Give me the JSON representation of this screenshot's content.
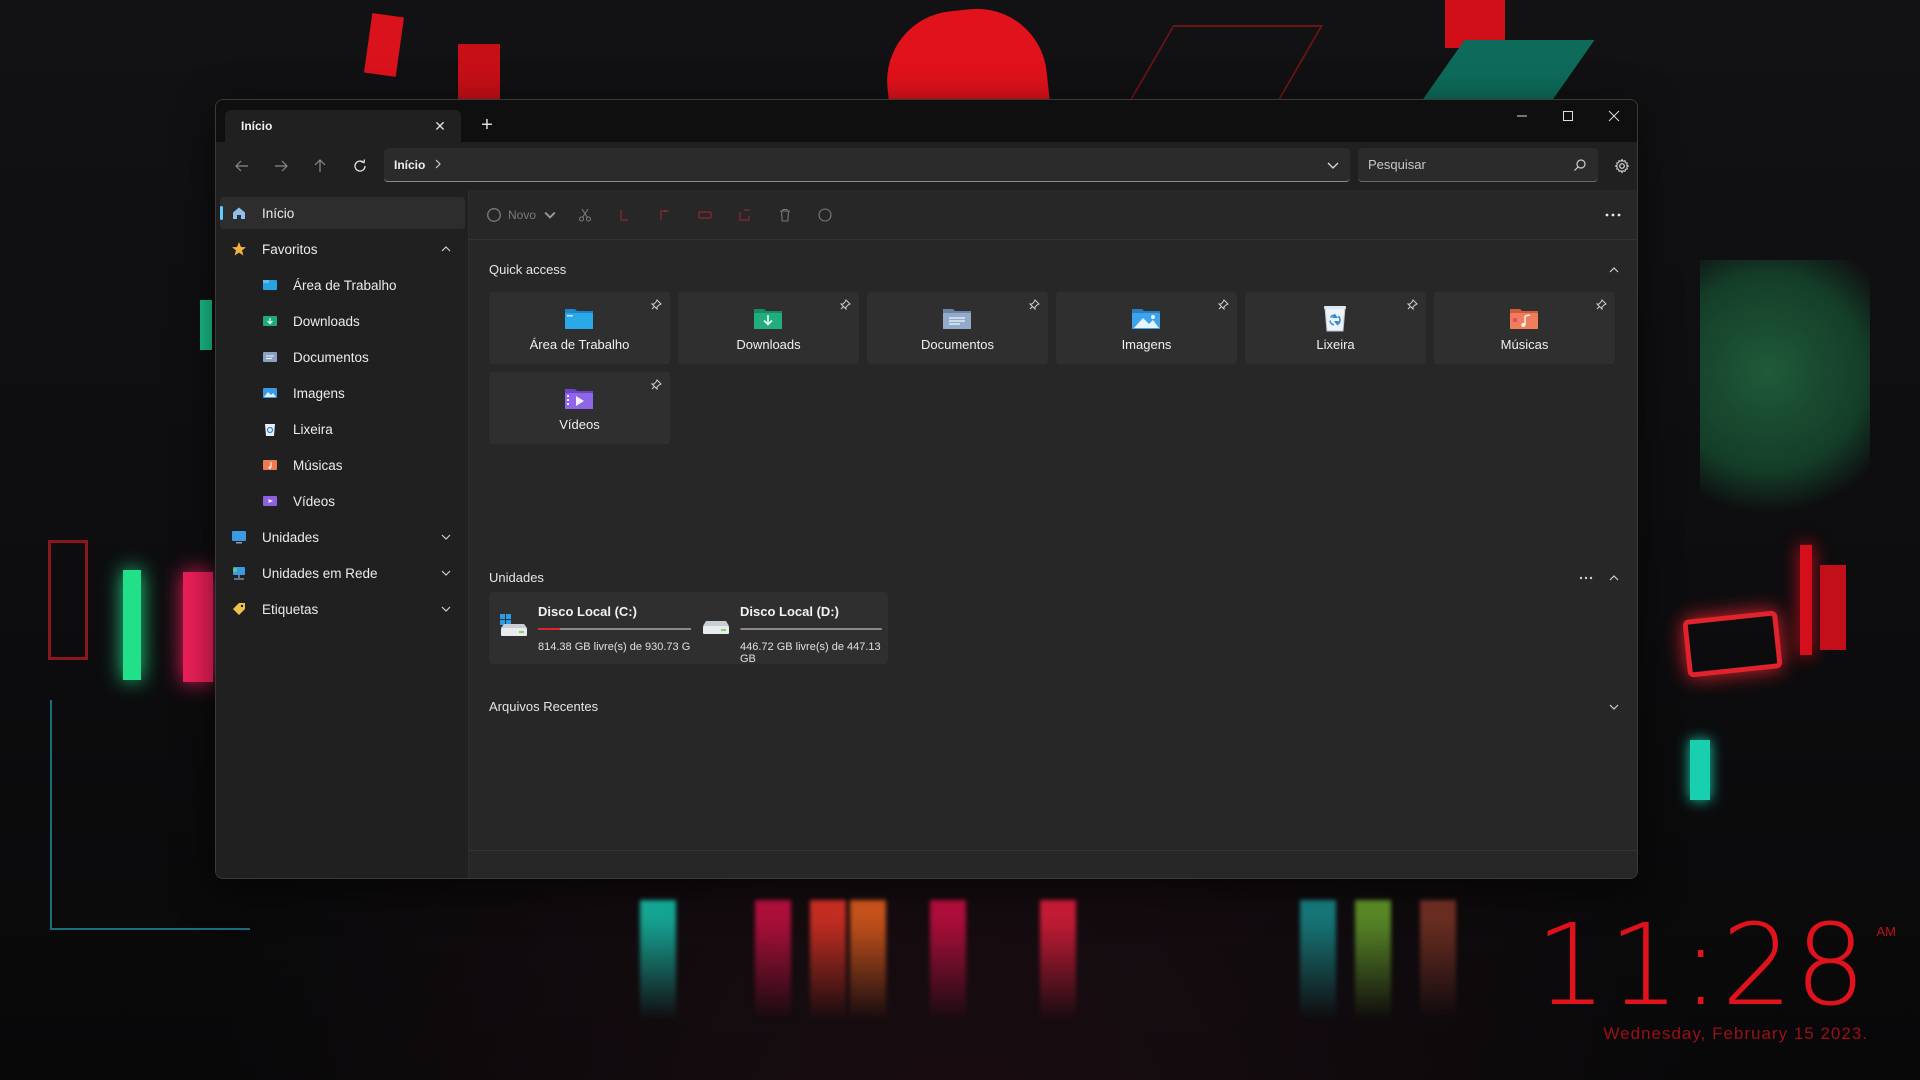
{
  "window": {
    "tab_title": "Início",
    "controls": {
      "minimize": "—",
      "maximize": "☐",
      "close": "✕"
    }
  },
  "nav": {
    "breadcrumb": [
      "Início"
    ],
    "search_placeholder": "Pesquisar"
  },
  "sidebar": {
    "items": [
      {
        "label": "Início",
        "icon": "home-icon",
        "color": "#7fb6e6",
        "active": true,
        "level": 0
      },
      {
        "label": "Favoritos",
        "icon": "star-icon",
        "color": "#f2b33d",
        "level": 0,
        "expanded": true
      },
      {
        "label": "Área de Trabalho",
        "icon": "desktop-folder-icon",
        "color": "#27a3e4",
        "level": 1
      },
      {
        "label": "Downloads",
        "icon": "downloads-folder-icon",
        "color": "#22a97a",
        "level": 1
      },
      {
        "label": "Documentos",
        "icon": "documents-folder-icon",
        "color": "#8aa2c2",
        "level": 1
      },
      {
        "label": "Imagens",
        "icon": "pictures-folder-icon",
        "color": "#3a9be4",
        "level": 1
      },
      {
        "label": "Lixeira",
        "icon": "recycle-bin-icon",
        "color": "#dfe8f0",
        "level": 1
      },
      {
        "label": "Músicas",
        "icon": "music-folder-icon",
        "color": "#ee7a55",
        "level": 1
      },
      {
        "label": "Vídeos",
        "icon": "videos-folder-icon",
        "color": "#8a62e0",
        "level": 1
      },
      {
        "label": "Unidades",
        "icon": "drives-icon",
        "color": "#3a9be4",
        "level": 0,
        "expanded": false
      },
      {
        "label": "Unidades em Rede",
        "icon": "network-icon",
        "color": "#3a9be4",
        "level": 0,
        "expanded": false
      },
      {
        "label": "Etiquetas",
        "icon": "tag-icon",
        "color": "#f0c04a",
        "level": 0,
        "expanded": false
      }
    ]
  },
  "toolbar": {
    "new_label": "Novo"
  },
  "quick_access": {
    "title": "Quick access",
    "items": [
      {
        "label": "Área de Trabalho",
        "icon": "desktop-folder-icon"
      },
      {
        "label": "Downloads",
        "icon": "downloads-folder-icon"
      },
      {
        "label": "Documentos",
        "icon": "documents-folder-icon"
      },
      {
        "label": "Imagens",
        "icon": "pictures-folder-icon"
      },
      {
        "label": "Lixeira",
        "icon": "recycle-bin-icon"
      },
      {
        "label": "Músicas",
        "icon": "music-folder-icon"
      },
      {
        "label": "Vídeos",
        "icon": "videos-folder-icon"
      }
    ]
  },
  "drives": {
    "title": "Unidades",
    "items": [
      {
        "name": "Disco Local (C:)",
        "info": "814.38 GB livre(s) de 930.73 GB",
        "used_fraction": 0.125,
        "icon": "windows-drive-icon"
      },
      {
        "name": "Disco Local (D:)",
        "info": "446.72 GB livre(s) de 447.13 GB",
        "used_fraction": 0.001,
        "icon": "drive-icon"
      }
    ]
  },
  "recent": {
    "title": "Arquivos Recentes"
  },
  "clock": {
    "time": "11:28",
    "ampm": "AM",
    "date": "Wednesday, February 15 2023."
  }
}
